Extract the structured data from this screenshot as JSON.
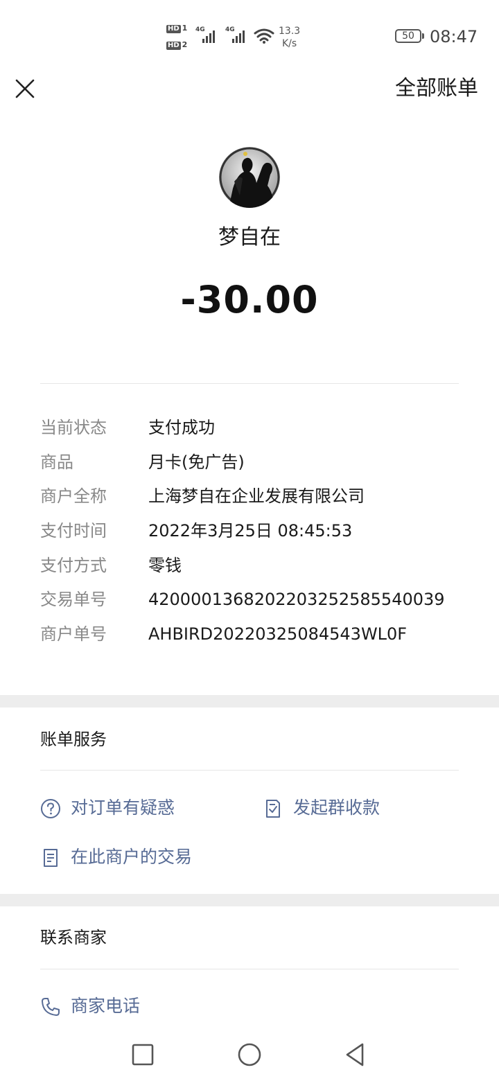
{
  "status_bar": {
    "hd1": "HD",
    "hd1_slot": "1",
    "hd2": "HD",
    "hd2_slot": "2",
    "net1": "4G",
    "net2": "4G",
    "speed_value": "13.3",
    "speed_unit": "K/s",
    "battery": "50",
    "time": "08:47",
    "icons": [
      "signal-icon",
      "wifi-icon",
      "battery-icon"
    ]
  },
  "nav": {
    "close_icon": "close-icon",
    "all_bills": "全部账单"
  },
  "header": {
    "merchant_name": "梦自在",
    "amount": "-30.00"
  },
  "details": [
    {
      "label": "当前状态",
      "value": "支付成功"
    },
    {
      "label": "商品",
      "value": "月卡(免广告)"
    },
    {
      "label": "商户全称",
      "value": "上海梦自在企业发展有限公司"
    },
    {
      "label": "支付时间",
      "value": "2022年3月25日 08:45:53"
    },
    {
      "label": "支付方式",
      "value": "零钱"
    },
    {
      "label": "交易单号",
      "value": "4200001368202203252585540039"
    },
    {
      "label": "商户单号",
      "value": "AHBIRD20220325084543WL0F"
    }
  ],
  "bill_service": {
    "title": "账单服务",
    "question_order": "对订单有疑惑",
    "group_collect": "发起群收款",
    "merchant_transactions": "在此商户的交易"
  },
  "contact": {
    "title": "联系商家",
    "phone": "商家电话"
  },
  "colors": {
    "link": "#576b95",
    "label": "#888888",
    "separator": "#ededed"
  }
}
